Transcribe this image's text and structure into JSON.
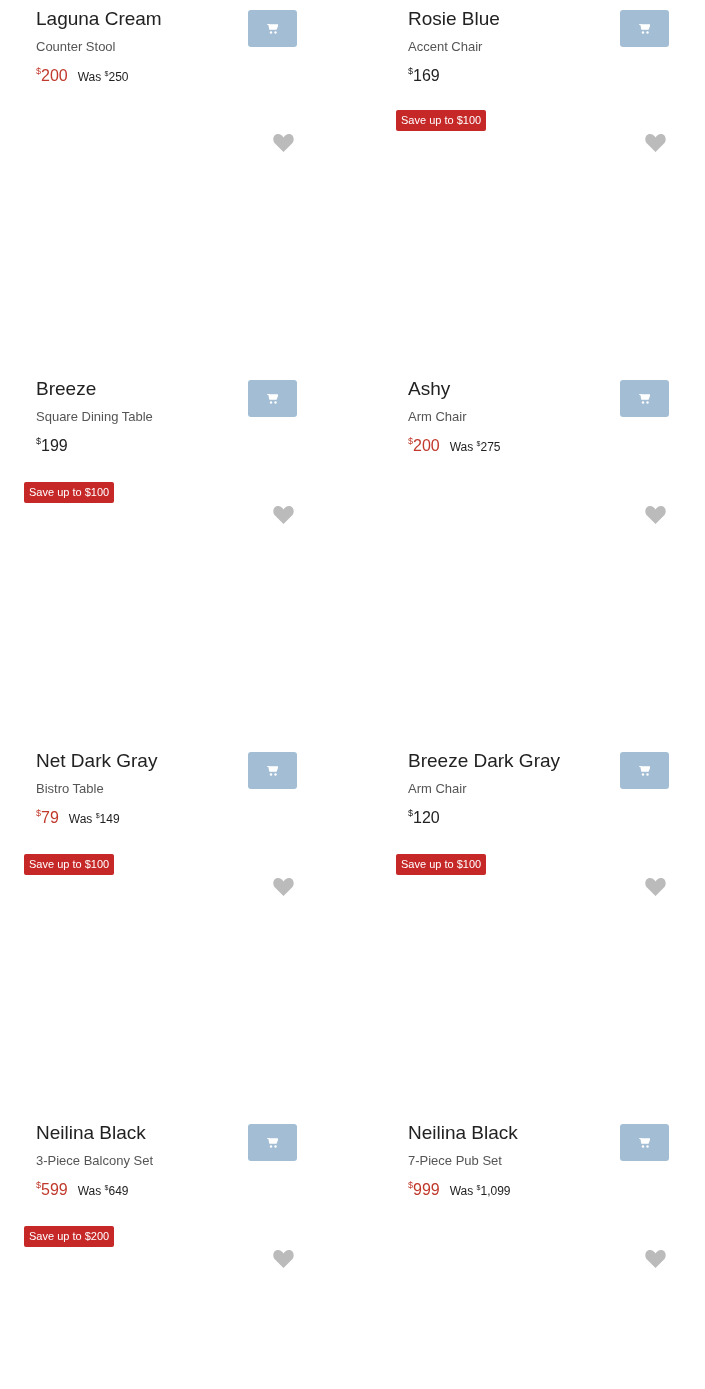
{
  "rows": [
    {
      "cells": [
        {
          "name": "Laguna Cream",
          "type": "Counter Stool",
          "price": {
            "symbol": "$",
            "amount": "200"
          },
          "was": {
            "label": "Was",
            "symbol": "$",
            "amount": "250"
          }
        },
        {
          "name": "Rosie Blue",
          "type": "Accent Chair",
          "price": {
            "symbol": "$",
            "amount": "169"
          }
        }
      ]
    },
    {
      "cells": [
        {
          "image": {
            "wishlisted": false
          },
          "name": "Breeze",
          "type": "Square Dining Table",
          "price": {
            "symbol": "$",
            "amount": "199"
          }
        },
        {
          "image": {
            "wishlisted": false,
            "badge": "Save up to $100"
          },
          "name": "Ashy",
          "type": "Arm Chair",
          "price": {
            "symbol": "$",
            "amount": "200"
          },
          "was": {
            "label": "Was",
            "symbol": "$",
            "amount": "275"
          }
        }
      ]
    },
    {
      "cells": [
        {
          "image": {
            "wishlisted": false,
            "badge": "Save up to $100"
          },
          "name": "Net Dark Gray",
          "type": "Bistro Table",
          "price": {
            "symbol": "$",
            "amount": "79"
          },
          "was": {
            "label": "Was",
            "symbol": "$",
            "amount": "149"
          }
        },
        {
          "image": {
            "wishlisted": false
          },
          "name": "Breeze Dark Gray",
          "type": "Arm Chair",
          "price": {
            "symbol": "$",
            "amount": "120"
          }
        }
      ]
    },
    {
      "cells": [
        {
          "image": {
            "wishlisted": false,
            "badge": "Save up to $100"
          },
          "name": "Neilina Black",
          "type": "3-Piece Balcony Set",
          "price": {
            "symbol": "$",
            "amount": "599"
          },
          "was": {
            "label": "Was",
            "symbol": "$",
            "amount": "649"
          }
        },
        {
          "image": {
            "wishlisted": false,
            "badge": "Save up to $100"
          },
          "name": "Neilina Black",
          "type": "7-Piece Pub Set",
          "price": {
            "symbol": "$",
            "amount": "999"
          },
          "was": {
            "label": "Was",
            "symbol": "$",
            "amount": "1,099"
          }
        }
      ]
    },
    {
      "cells": [
        {
          "image": {
            "wishlisted": false,
            "badge": "Save up to $200"
          }
        },
        {
          "image": {
            "wishlisted": false
          }
        }
      ]
    }
  ]
}
